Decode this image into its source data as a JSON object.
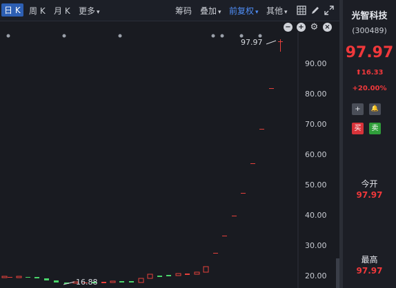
{
  "toolbar": {
    "tabs": [
      {
        "label": "日 K",
        "active": true
      },
      {
        "label": "周 K",
        "active": false
      },
      {
        "label": "月 K",
        "active": false
      }
    ],
    "more_label": "更多",
    "right_items": {
      "chips": "筹码",
      "overlay": "叠加",
      "adjust": "前复权",
      "other": "其他"
    }
  },
  "chart": {
    "high_annotation": "97.97",
    "low_annotation": "16.88",
    "price_axis": [
      "90.00",
      "80.00",
      "70.00",
      "60.00",
      "50.00",
      "40.00",
      "30.00",
      "20.00"
    ],
    "colors": {
      "up": "#e8413b",
      "down": "#4ad66b"
    }
  },
  "stock": {
    "name": "光智科技",
    "code": "(300489)",
    "price": "97.97",
    "change_abs": "16.33",
    "change_pct": "+20.00%",
    "buy_label": "买",
    "sell_label": "卖",
    "open_label": "今开",
    "open_value": "97.97",
    "high_label": "最高",
    "high_value": "97.97"
  }
}
